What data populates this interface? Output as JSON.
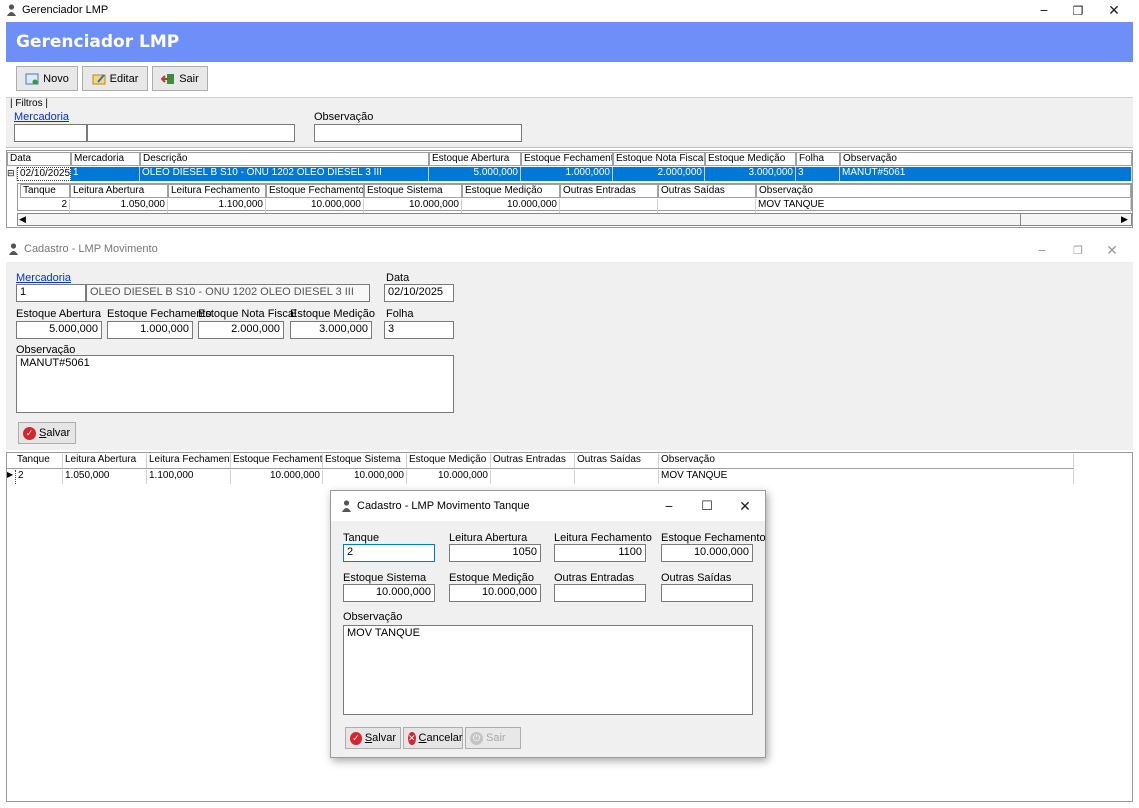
{
  "window": {
    "title": "Gerenciador LMP"
  },
  "header": {
    "title": "Gerenciador LMP"
  },
  "toolbar": {
    "novo": "Novo",
    "editar": "Editar",
    "sair": "Sair"
  },
  "filters": {
    "group_label": "| Filtros |",
    "mercadoria_label": "Mercadoria",
    "observacao_label": "Observação"
  },
  "main_grid": {
    "columns": [
      "Data",
      "Mercadoria",
      "Descrição",
      "Estoque Abertura",
      "Estoque Fechamento",
      "Estoque Nota Fiscal",
      "Estoque Medição",
      "Folha",
      "Observação"
    ],
    "row": {
      "expander": "⊟",
      "data": "02/10/2025",
      "mercadoria": "1",
      "descricao": "OLEO DIESEL B S10 - ONU 1202 OLEO DIESEL 3 III",
      "estoque_abertura": "5.000,000",
      "estoque_fechamento": "1.000,000",
      "estoque_nota_fiscal": "2.000,000",
      "estoque_medicao": "3.000,000",
      "folha": "3",
      "observacao": "MANUT#5061"
    },
    "detail_columns": [
      "Tanque",
      "Leitura Abertura",
      "Leitura Fechamento",
      "Estoque Fechamento",
      "Estoque Sistema",
      "Estoque Medição",
      "Outras Entradas",
      "Outras Saídas",
      "Observação"
    ],
    "detail_row": {
      "tanque": "2",
      "leitura_abertura": "1.050,000",
      "leitura_fechamento": "1.100,000",
      "estoque_fechamento": "10.000,000",
      "estoque_sistema": "10.000,000",
      "estoque_medicao": "10.000,000",
      "outras_entradas": "",
      "outras_saidas": "",
      "observacao": "MOV TANQUE"
    }
  },
  "movimento": {
    "title": "Cadastro - LMP Movimento",
    "mercadoria_label": "Mercadoria",
    "mercadoria_code": "1",
    "mercadoria_desc": "OLEO DIESEL B S10 - ONU 1202 OLEO DIESEL 3 III",
    "data_label": "Data",
    "data_value": "02/10/2025",
    "estoque_abertura_label": "Estoque Abertura",
    "estoque_abertura": "5.000,000",
    "estoque_fechamento_label": "Estoque Fechamento",
    "estoque_fechamento": "1.000,000",
    "estoque_nota_fiscal_label": "Estoque Nota Fiscal",
    "estoque_nota_fiscal": "2.000,000",
    "estoque_medicao_label": "Estoque Medição",
    "estoque_medicao": "3.000,000",
    "folha_label": "Folha",
    "folha": "3",
    "observacao_label": "Observação",
    "observacao": "MANUT#5061",
    "salvar": "Salvar",
    "grid_columns": [
      "Tanque",
      "Leitura Abertura",
      "Leitura Fechamento",
      "Estoque Fechamento",
      "Estoque Sistema",
      "Estoque Medição",
      "Outras Entradas",
      "Outras Saídas",
      "Observação"
    ],
    "grid_row": {
      "indicator": "▶",
      "tanque": "2",
      "leitura_abertura": "1.050,000",
      "leitura_fechamento": "1.100,000",
      "estoque_fechamento": "10.000,000",
      "estoque_sistema": "10.000,000",
      "estoque_medicao": "10.000,000",
      "outras_entradas": "",
      "outras_saidas": "",
      "observacao": "MOV TANQUE"
    }
  },
  "tanque_dialog": {
    "title": "Cadastro - LMP Movimento Tanque",
    "tanque_label": "Tanque",
    "tanque": "2",
    "leitura_abertura_label": "Leitura Abertura",
    "leitura_abertura": "1050",
    "leitura_fechamento_label": "Leitura Fechamento",
    "leitura_fechamento": "1100",
    "estoque_fechamento_label": "Estoque Fechamento",
    "estoque_fechamento": "10.000,000",
    "estoque_sistema_label": "Estoque Sistema",
    "estoque_sistema": "10.000,000",
    "estoque_medicao_label": "Estoque Medição",
    "estoque_medicao": "10.000,000",
    "outras_entradas_label": "Outras Entradas",
    "outras_entradas": "",
    "outras_saidas_label": "Outras Saídas",
    "outras_saidas": "",
    "observacao_label": "Observação",
    "observacao": "MOV TANQUE",
    "salvar": "Salvar",
    "cancelar": "Cancelar",
    "sair": "Sair"
  },
  "colors": {
    "header": "#6d8ff7",
    "selection": "#0078d7",
    "link": "#0033cc",
    "danger": "#d9242f"
  }
}
